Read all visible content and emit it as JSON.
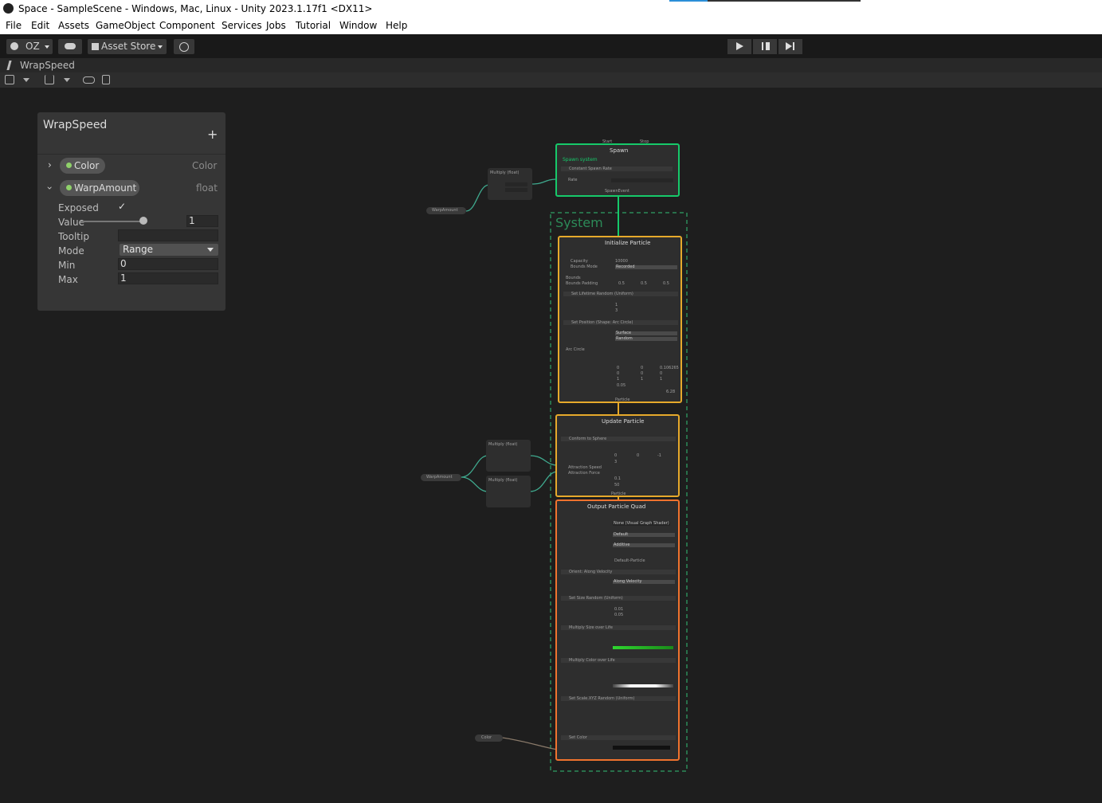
{
  "window": {
    "title": "Space - SampleScene - Windows, Mac, Linux - Unity 2023.1.17f1 <DX11>"
  },
  "menu": [
    "File",
    "Edit",
    "Assets",
    "GameObject",
    "Component",
    "Services",
    "Jobs",
    "Tutorial",
    "Window",
    "Help"
  ],
  "toolbar": {
    "account": "OZ",
    "asset_store": "Asset Store"
  },
  "tab": {
    "label": "WrapSpeed"
  },
  "blackboard": {
    "title": "WrapSpeed",
    "add_symbol": "+",
    "properties": [
      {
        "name": "Color",
        "type": "Color"
      },
      {
        "name": "WarpAmount",
        "type": "float"
      }
    ],
    "labels": {
      "exposed": "Exposed",
      "value": "Value",
      "tooltip": "Tooltip",
      "mode": "Mode",
      "min": "Min",
      "max": "Max"
    },
    "values": {
      "exposed": "✓",
      "value": "1",
      "mode": "Range",
      "min": "0",
      "max": "1"
    }
  },
  "graph": {
    "spawn": {
      "title": "Spawn",
      "subtitle": "Spawn system",
      "block": "Constant Spawn Rate",
      "rate_label": "Rate",
      "start": "Start",
      "stop": "Stop",
      "event": "SpawnEvent"
    },
    "system_label": "System",
    "initialize": {
      "title": "Initialize Particle",
      "capacity_label": "Capacity",
      "capacity": "10000",
      "bounds_mode_label": "Bounds Mode",
      "bounds_mode": "Recorded",
      "bounds_label": "Bounds",
      "padding_label": "Bounds Padding",
      "padding": [
        "0.5",
        "0.5",
        "0.5"
      ],
      "block1": "Set Lifetime Random (Uniform)",
      "a": "1",
      "b": "3",
      "block2": "Set Position (Shape: Arc Circle)",
      "pos_mode": "Surface",
      "spawn_mode": "Random",
      "arc_circle": "Arc Circle",
      "position": [
        "0",
        "0",
        "0.106265"
      ],
      "angles": [
        "0",
        "0",
        "0"
      ],
      "scale": [
        "1",
        "1",
        "1"
      ],
      "radius": "0.05",
      "arc": "6.28",
      "out": "Particle"
    },
    "update": {
      "title": "Update Particle",
      "block": "Conform to Sphere",
      "center": [
        "0",
        "0",
        "-1"
      ],
      "radius": "3",
      "attraction_speed": "Attraction Speed",
      "attraction_force": "Attraction Force",
      "stick_distance": "0.1",
      "stick_force": "50",
      "out": "Particle"
    },
    "output": {
      "title": "Output Particle Quad",
      "shader_graph": "None (Visual Graph Shader)",
      "uv_mode": "Default",
      "blend_mode": "Additive",
      "main_texture": "Default-Particle",
      "block1": "Orient: Along Velocity",
      "mode": "Along Velocity",
      "block2": "Set Size Random (Uniform)",
      "a": "0.01",
      "b": "0.05",
      "block3": "Multiply Size over Life",
      "block4": "Multiply Color over Life",
      "block5": "Set Scale.XYZ Random (Uniform)",
      "block6": "Set Color"
    },
    "multiply_label": "Multiply (float)",
    "warp_node": "WarpAmount",
    "color_node": "Color"
  },
  "colors": {
    "spawn_border": "#16c96a",
    "init_border": "#e6a92b",
    "update_border": "#e6a92b",
    "output_border": "#f0732e",
    "system_dashed": "#2c8a58",
    "wire": "#3fa98e"
  }
}
